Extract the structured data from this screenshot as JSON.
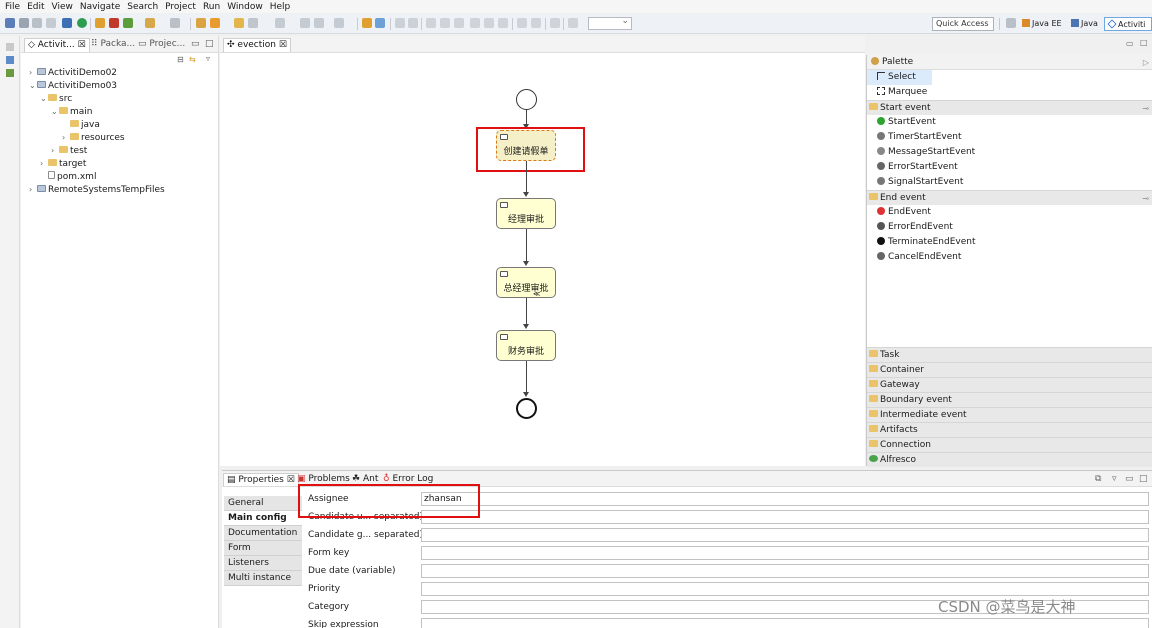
{
  "menu": [
    "File",
    "Edit",
    "View",
    "Navigate",
    "Search",
    "Project",
    "Run",
    "Window",
    "Help"
  ],
  "toolbar": {
    "quick_access": "Quick Access",
    "perspectives": [
      "Java EE",
      "Java",
      "Activiti"
    ],
    "active_perspective": "Activiti"
  },
  "explorer": {
    "tabs": [
      "Activit...",
      "Packa...",
      "Projec..."
    ],
    "tree": [
      {
        "label": "ActivitiDemo02",
        "depth": 0,
        "twisty": "›",
        "kind": "project"
      },
      {
        "label": "ActivitiDemo03",
        "depth": 0,
        "twisty": "⌄",
        "kind": "project"
      },
      {
        "label": "src",
        "depth": 1,
        "twisty": "⌄",
        "kind": "folder"
      },
      {
        "label": "main",
        "depth": 2,
        "twisty": "⌄",
        "kind": "folder"
      },
      {
        "label": "java",
        "depth": 3,
        "twisty": "",
        "kind": "folder"
      },
      {
        "label": "resources",
        "depth": 3,
        "twisty": "›",
        "kind": "folder"
      },
      {
        "label": "test",
        "depth": 2,
        "twisty": "›",
        "kind": "folder"
      },
      {
        "label": "target",
        "depth": 1,
        "twisty": "›",
        "kind": "folder"
      },
      {
        "label": "pom.xml",
        "depth": 1,
        "twisty": "",
        "kind": "file"
      },
      {
        "label": "RemoteSystemsTempFiles",
        "depth": 0,
        "twisty": "›",
        "kind": "project"
      }
    ]
  },
  "editor": {
    "tab": "evection",
    "tasks": [
      "创建请假单",
      "经理审批",
      "总经理审批",
      "财务审批"
    ],
    "selected_task": 0
  },
  "palette": {
    "title": "Palette",
    "tools": [
      "Select",
      "Marquee"
    ],
    "drawers_open": [
      {
        "name": "Start event",
        "items": [
          "StartEvent",
          "TimerStartEvent",
          "MessageStartEvent",
          "ErrorStartEvent",
          "SignalStartEvent"
        ]
      },
      {
        "name": "End event",
        "items": [
          "EndEvent",
          "ErrorEndEvent",
          "TerminateEndEvent",
          "CancelEndEvent"
        ]
      }
    ],
    "drawers_closed": [
      "Task",
      "Container",
      "Gateway",
      "Boundary event",
      "Intermediate event",
      "Artifacts",
      "Connection",
      "Alfresco"
    ]
  },
  "properties": {
    "tabs": [
      "Properties",
      "Problems",
      "Ant",
      "Error Log"
    ],
    "side_tabs": [
      "General",
      "Main config",
      "Documentation",
      "Form",
      "Listeners",
      "Multi instance"
    ],
    "active_side_tab": "Main config",
    "fields": [
      {
        "label": "Assignee",
        "value": "zhansan"
      },
      {
        "label": "Candidate u... separated)",
        "value": ""
      },
      {
        "label": "Candidate g... separated)",
        "value": ""
      },
      {
        "label": "Form key",
        "value": ""
      },
      {
        "label": "Due date (variable)",
        "value": ""
      },
      {
        "label": "Priority",
        "value": ""
      },
      {
        "label": "Category",
        "value": ""
      },
      {
        "label": "Skip expression",
        "value": ""
      }
    ]
  },
  "watermark": "CSDN @菜鸟是大神",
  "colors": {
    "task_fill": "#ffffd2",
    "highlight": "#e01010",
    "selection": "#d87a1a"
  }
}
